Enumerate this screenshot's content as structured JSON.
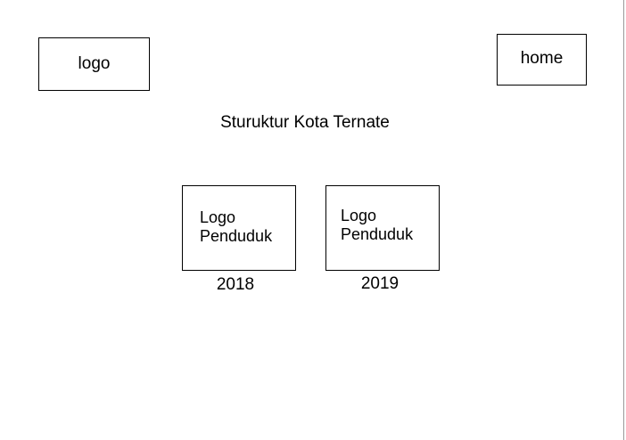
{
  "header": {
    "logo_label": "logo",
    "home_label": "home"
  },
  "main": {
    "title": "Sturuktur Kota Ternate",
    "cards": [
      {
        "line1": "Logo",
        "line2": "Penduduk",
        "year": "2018"
      },
      {
        "line1": "Logo",
        "line2": "Penduduk",
        "year": "2019"
      }
    ]
  }
}
